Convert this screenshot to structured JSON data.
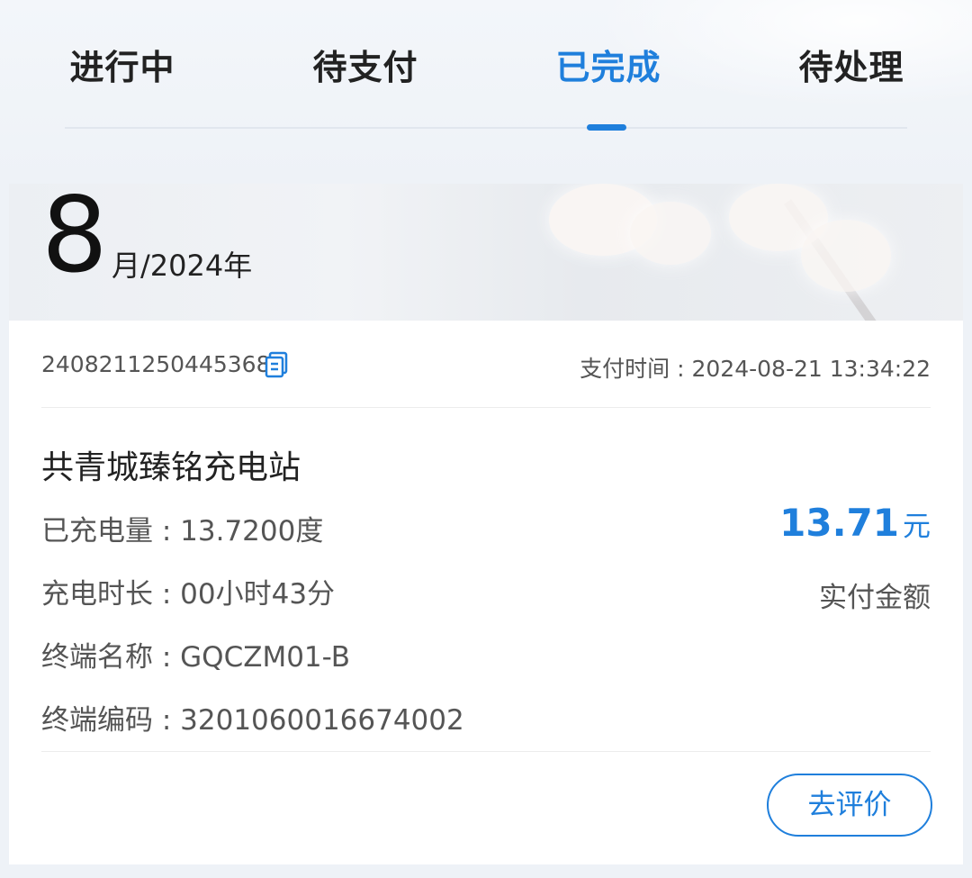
{
  "tabs": [
    {
      "label": "进行中",
      "active": false
    },
    {
      "label": "待支付",
      "active": false
    },
    {
      "label": "已完成",
      "active": true
    },
    {
      "label": "待处理",
      "active": false
    }
  ],
  "month_header": {
    "month": "8",
    "suffix": "月/2024年"
  },
  "order": {
    "order_no": "2408211250445368",
    "copy_icon": "copy-icon",
    "pay_time_label": "支付时间",
    "pay_time_separator": " : ",
    "pay_time_value": "2024-08-21 13:34:22",
    "station_name": "共青城臻铭充电站",
    "details": [
      {
        "key": "已充电量 : ",
        "value": "13.7200度"
      },
      {
        "key": "充电时长 : ",
        "value": "00小时43分"
      },
      {
        "key": "终端名称 : ",
        "value": "GQCZM01-B"
      },
      {
        "key": "终端编码 : ",
        "value": "3201060016674002"
      }
    ],
    "amount": "13.71",
    "amount_unit": "元",
    "amount_label": "实付金额",
    "review_button": "去评价"
  },
  "colors": {
    "accent": "#1f7fdc",
    "text_primary": "#222222",
    "text_secondary": "#555555",
    "background": "#eef2f7"
  }
}
